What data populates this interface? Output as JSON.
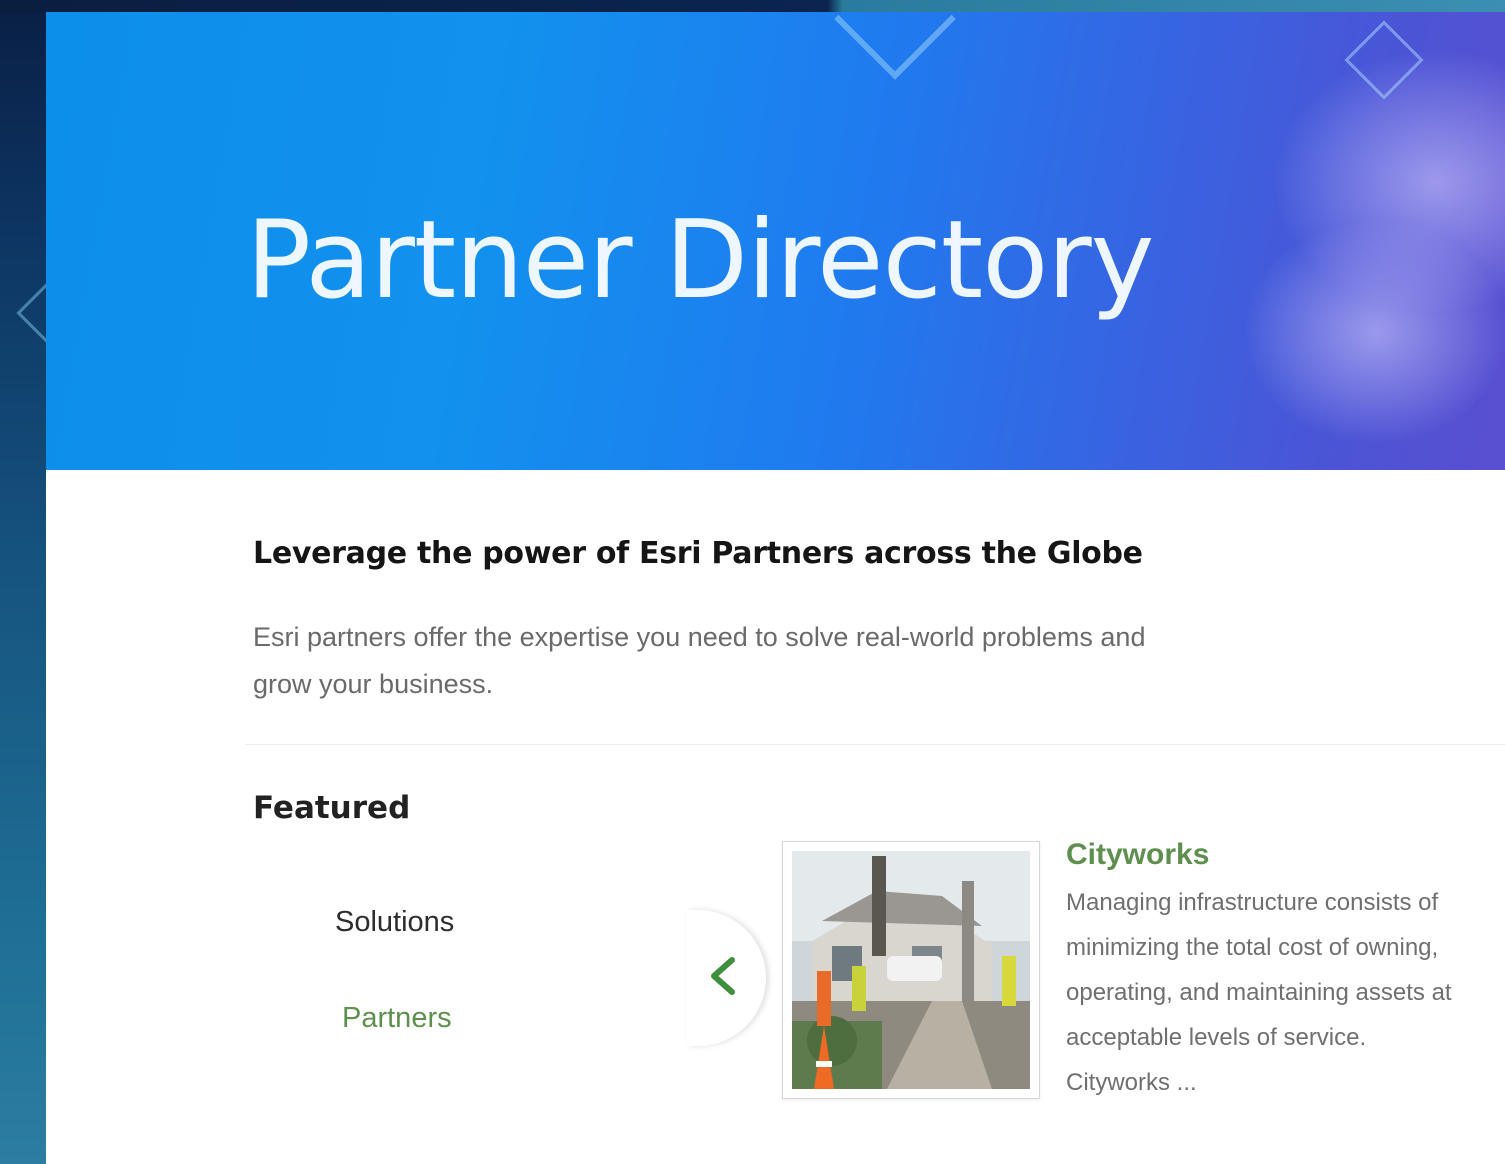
{
  "hero": {
    "title": "Partner Directory"
  },
  "intro": {
    "heading": "Leverage the power of Esri Partners across the Globe",
    "text": "Esri partners offer the expertise you need to solve real-world problems and grow your business."
  },
  "featured": {
    "heading": "Featured",
    "filters": [
      {
        "label": "Solutions",
        "active": false
      },
      {
        "label": "Partners",
        "active": true
      }
    ],
    "carousel": {
      "prev_icon": "chevron-left-icon",
      "item": {
        "title": "Cityworks",
        "description": "Managing infrastructure consists of minimizing the total cost of owning, operating, and maintaining assets at acceptable levels of service. Cityworks ..."
      }
    }
  },
  "colors": {
    "accent_green": "#5e8f4e",
    "hero_blue": "#1291ee",
    "heading_text": "#151515",
    "body_text": "#6a6a6a"
  }
}
